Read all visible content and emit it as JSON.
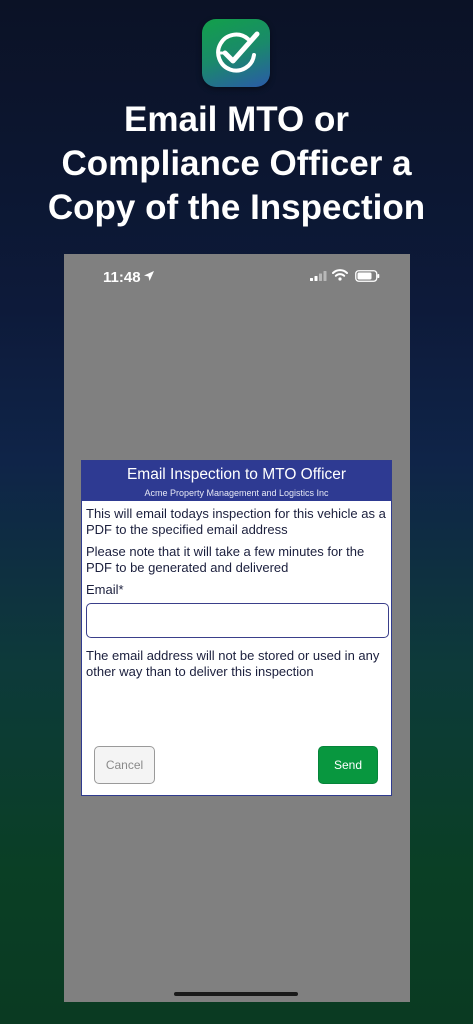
{
  "headline": "Email MTO or Compliance Officer a Copy of the Inspection",
  "status_bar": {
    "time": "11:48",
    "icons": [
      "location-arrow-icon",
      "signal-icon",
      "wifi-icon",
      "battery-icon"
    ]
  },
  "dialog": {
    "title": "Email Inspection to MTO Officer",
    "subtitle": "Acme Property Management and Logistics Inc",
    "paragraph1": "This will email todays inspection for this vehicle as a PDF to the specified email address",
    "paragraph2": "Please note that it will take a few minutes for the PDF to be generated and delivered",
    "email_label": "Email*",
    "email_value": "",
    "email_placeholder": "",
    "note": "The email address will not be stored or used in any other way than to deliver this inspection",
    "cancel_label": "Cancel",
    "send_label": "Send"
  },
  "colors": {
    "header": "#2e3a92",
    "send_button": "#08973f",
    "screen_overlay": "#808080"
  }
}
